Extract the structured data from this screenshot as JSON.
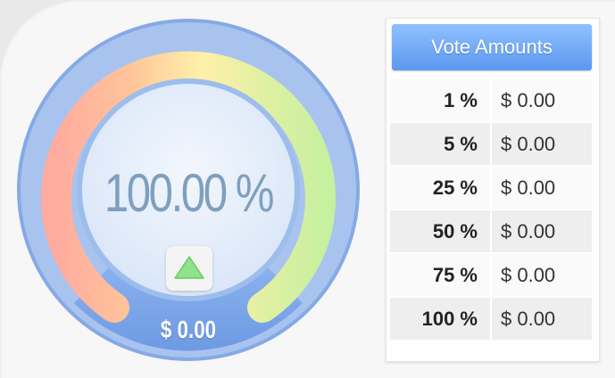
{
  "gauge": {
    "percent_text": "100.00 %",
    "value_text": "$ 0.00",
    "level": 1.0,
    "colors": {
      "outer_ring": "#7fa4e3",
      "inner_face": "#e4eefb",
      "arc_start": "#ffb0a6",
      "arc_mid": "#fff0a8",
      "arc_end": "#c9f0a0",
      "up_arrow": "#8ee38c"
    },
    "up_button_icon": "triangle-up-icon"
  },
  "vote_amounts": {
    "title": "Vote Amounts",
    "rows": [
      {
        "percent": "1 %",
        "amount": "$ 0.00"
      },
      {
        "percent": "5 %",
        "amount": "$ 0.00"
      },
      {
        "percent": "25 %",
        "amount": "$ 0.00"
      },
      {
        "percent": "50 %",
        "amount": "$ 0.00"
      },
      {
        "percent": "75 %",
        "amount": "$ 0.00"
      },
      {
        "percent": "100 %",
        "amount": "$ 0.00"
      }
    ]
  }
}
